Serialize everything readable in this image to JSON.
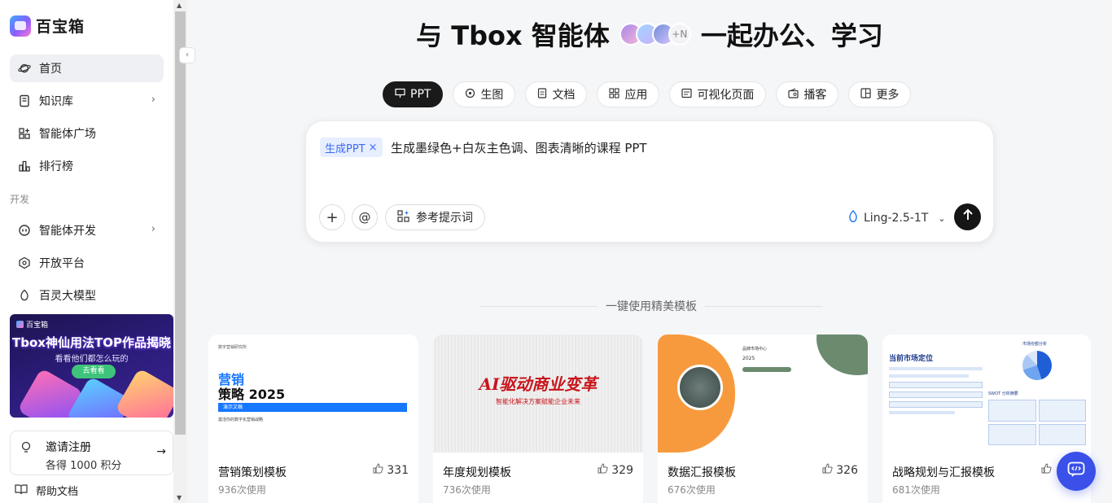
{
  "app": {
    "name": "百宝箱"
  },
  "sidebar": {
    "items": [
      {
        "label": "首页",
        "icon": "planet-icon",
        "active": true
      },
      {
        "label": "知识库",
        "icon": "book-icon",
        "has_chevron": true
      },
      {
        "label": "智能体广场",
        "icon": "grid-plus-icon"
      },
      {
        "label": "排行榜",
        "icon": "bar-chart-icon"
      }
    ],
    "section_dev": "开发",
    "dev_items": [
      {
        "label": "智能体开发",
        "icon": "robot-icon",
        "has_chevron": true
      },
      {
        "label": "开放平台",
        "icon": "platform-icon"
      },
      {
        "label": "百灵大模型",
        "icon": "model-icon"
      }
    ],
    "banner": {
      "brand": "百宝箱",
      "title": "Tbox神仙用法TOP作品揭晓",
      "subtitle": "看看他们都怎么玩的",
      "button": "去看看"
    },
    "invite": {
      "title": "邀请注册",
      "subtitle": "各得 1000 积分"
    },
    "help": "帮助文档"
  },
  "hero": {
    "before": "与 Tbox 智能体",
    "after": "一起办公、学习",
    "avatar_more": "+N"
  },
  "tabs": [
    {
      "label": "PPT",
      "icon": "presentation-icon",
      "active": true
    },
    {
      "label": "生图",
      "icon": "image-gen-icon"
    },
    {
      "label": "文档",
      "icon": "document-icon"
    },
    {
      "label": "应用",
      "icon": "apps-icon"
    },
    {
      "label": "可视化页面",
      "icon": "page-icon"
    },
    {
      "label": "播客",
      "icon": "radio-icon"
    },
    {
      "label": "更多",
      "icon": "more-grid-icon"
    }
  ],
  "composer": {
    "chip": "生成PPT",
    "prompt": "生成墨绿色+白灰主色调、图表清晰的课程 PPT",
    "ref_button": "参考提示词",
    "model": "Ling-2.5-1T"
  },
  "templates_heading": "一键使用精美模板",
  "cards": [
    {
      "title": "营销策划模板",
      "likes": "331",
      "uses": "936次使用",
      "thumb": {
        "kicker": "数字营销研究所",
        "line1": "营销",
        "line2": "策略 2025",
        "bar": "演示文稿",
        "caption": "激活你的数字化营销战略"
      }
    },
    {
      "title": "年度规划模板",
      "likes": "329",
      "uses": "736次使用",
      "thumb": {
        "headline": "AI驱动商业变革",
        "sub": "智能化解决方案赋能企业未来"
      }
    },
    {
      "title": "数据汇报模板",
      "likes": "326",
      "uses": "676次使用",
      "thumb": {
        "org": "品牌市场中心",
        "year": "2025"
      }
    },
    {
      "title": "战略规划与汇报模板",
      "likes": "",
      "uses": "681次使用",
      "thumb": {
        "headline": "当前市场定位",
        "chart_title": "市场份额分析",
        "swot": "SWOT 分析摘要"
      }
    }
  ],
  "colors": {
    "accent": "#3a50e8",
    "chip_bg": "#e6eeff",
    "chip_text": "#3d6af0",
    "card1_bar": "#1677ff",
    "card3_orange": "#f79a3e",
    "card3_green": "#6b8a6e",
    "card2_red": "#c8141b"
  }
}
